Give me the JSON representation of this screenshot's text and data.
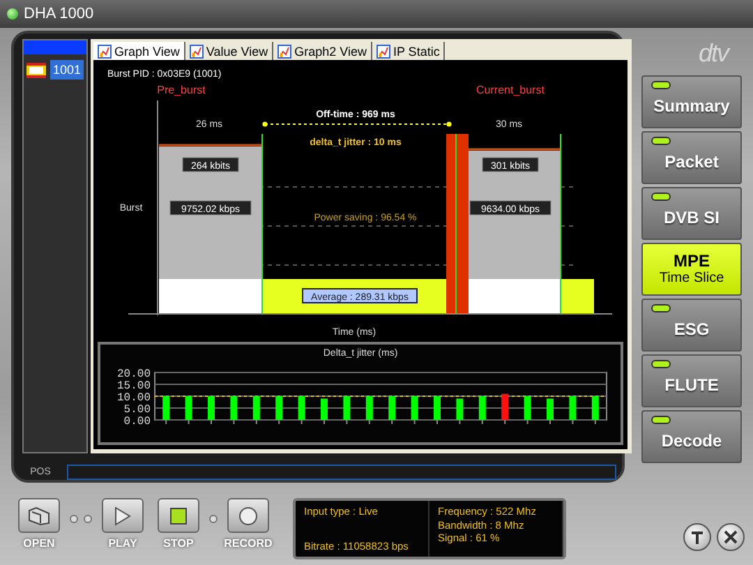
{
  "window": {
    "title": "DHA 1000"
  },
  "logo": {
    "text": "dtv"
  },
  "streams": [
    {
      "label": "1001",
      "selected": true
    }
  ],
  "tabs": [
    {
      "label": "Graph View",
      "selected": true
    },
    {
      "label": "Value View",
      "selected": false
    },
    {
      "label": "Graph2 View",
      "selected": false
    },
    {
      "label": "IP Static",
      "selected": false
    }
  ],
  "burst_view": {
    "pid": "Burst PID : 0x03E9 (1001)",
    "pre_label": "Pre_burst",
    "current_label": "Current_burst",
    "pre_duration": "26 ms",
    "current_duration": "30 ms",
    "off_time": "Off-time : 969 ms",
    "jitter": "delta_t jitter : 10 ms",
    "pre_size": "264 kbits",
    "current_size": "301 kbits",
    "pre_rate": "9752.02 kbps",
    "current_rate": "9634.00 kbps",
    "y_label": "Burst",
    "power_saving": "Power saving : 96.54 %",
    "average": "Average : 289.31 kbps",
    "x_label": "Time (ms)"
  },
  "jitter_chart": {
    "chart_data": {
      "type": "bar",
      "title": "Delta_t jitter (ms)",
      "stacked": true,
      "grid": true,
      "series": [
        {
          "color": "#00ff00",
          "values": [
            10,
            10,
            10,
            10,
            10,
            10,
            10,
            9,
            10,
            10,
            10,
            10,
            10,
            9,
            10,
            null,
            10,
            9,
            10,
            10
          ]
        },
        {
          "color": "#ff1010",
          "values": [
            null,
            null,
            null,
            null,
            null,
            null,
            null,
            null,
            null,
            null,
            null,
            null,
            null,
            null,
            null,
            11,
            null,
            null,
            null,
            null
          ]
        }
      ],
      "ylim": [
        0,
        20
      ],
      "yticks": [
        {
          "value": 0,
          "label": "0.00"
        },
        {
          "value": 5,
          "label": "5.00"
        },
        {
          "value": 10,
          "label": "10.00"
        },
        {
          "value": 15,
          "label": "15.00"
        },
        {
          "value": 20,
          "label": "20.00"
        }
      ],
      "ref_lines": [
        {
          "axis": "y",
          "value": 10,
          "color": "#e0c000"
        }
      ]
    }
  },
  "position": {
    "label": "POS"
  },
  "transport": [
    {
      "label": "OPEN",
      "kind": "open"
    },
    {
      "label": "PLAY",
      "kind": "play"
    },
    {
      "label": "STOP",
      "kind": "stop"
    },
    {
      "label": "RECORD",
      "kind": "record"
    }
  ],
  "info": {
    "input_type": "Input type : Live",
    "bitrate": "Bitrate : 11058823 bps",
    "frequency": "Frequency : 522 Mhz",
    "bandwidth": "Bandwidth : 8 Mhz",
    "signal": "Signal : 61 %"
  },
  "nav": [
    {
      "label": "Summary",
      "selected": false
    },
    {
      "label": "Packet",
      "selected": false
    },
    {
      "label": "DVB SI",
      "selected": false
    },
    {
      "label": "MPE",
      "sublabel": "Time Slice",
      "selected": true
    },
    {
      "label": "ESG",
      "selected": false
    },
    {
      "label": "FLUTE",
      "selected": false
    },
    {
      "label": "Decode",
      "selected": false
    }
  ]
}
